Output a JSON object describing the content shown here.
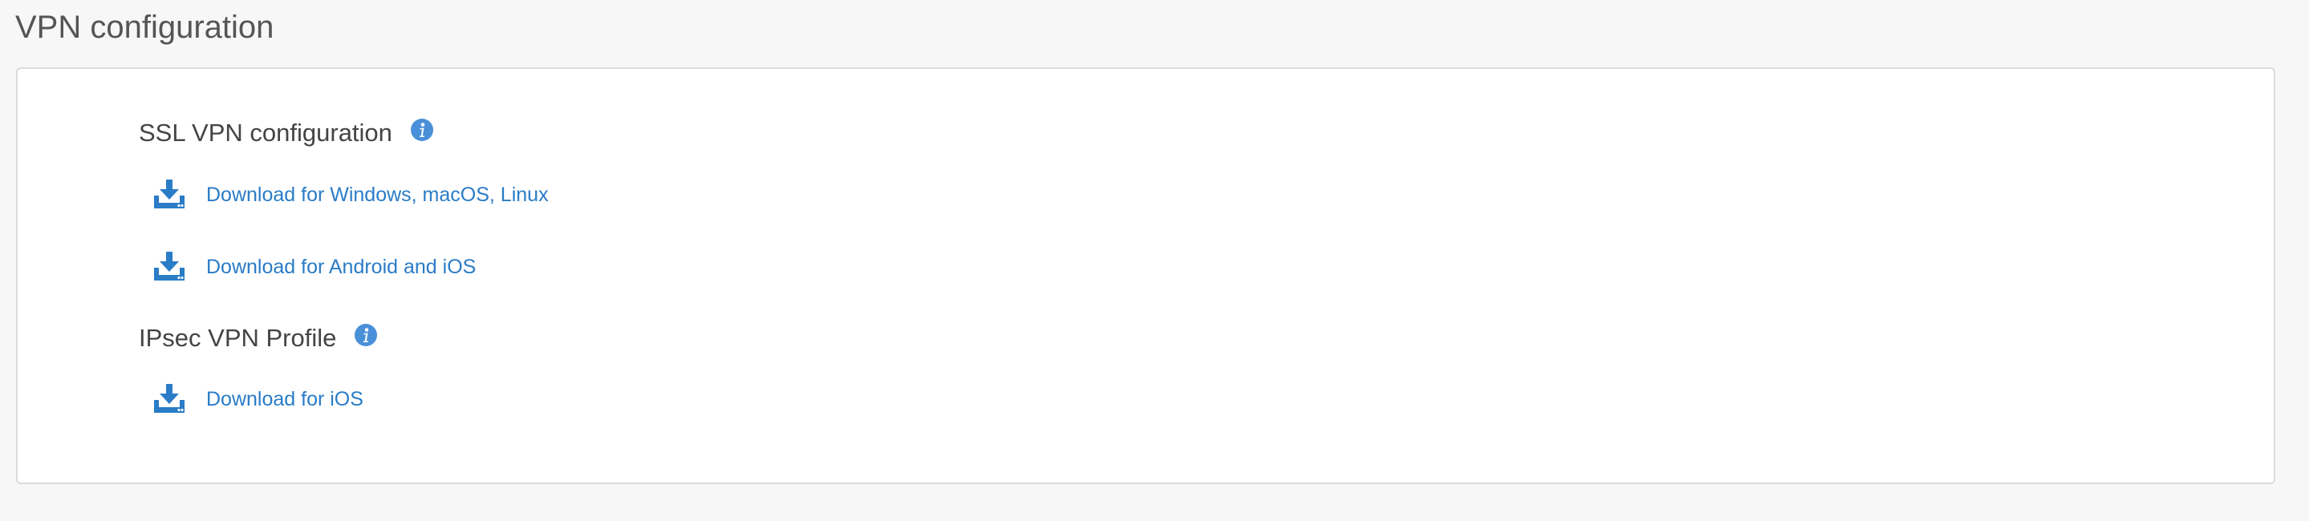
{
  "page": {
    "title": "VPN configuration"
  },
  "sections": [
    {
      "heading": "SSL VPN configuration",
      "info_icon": "info-icon",
      "links": [
        {
          "label": "Download for Windows, macOS, Linux",
          "icon": "download-icon"
        },
        {
          "label": "Download for Android and iOS",
          "icon": "download-icon"
        }
      ]
    },
    {
      "heading": "IPsec VPN Profile",
      "info_icon": "info-icon",
      "links": [
        {
          "label": "Download for iOS",
          "icon": "download-icon"
        }
      ]
    }
  ],
  "colors": {
    "link": "#2a7cc7",
    "info_icon": "#4a90d9",
    "heading": "#444444",
    "title": "#555555",
    "background": "#f7f7f7",
    "panel_border": "#dcdcdc"
  }
}
